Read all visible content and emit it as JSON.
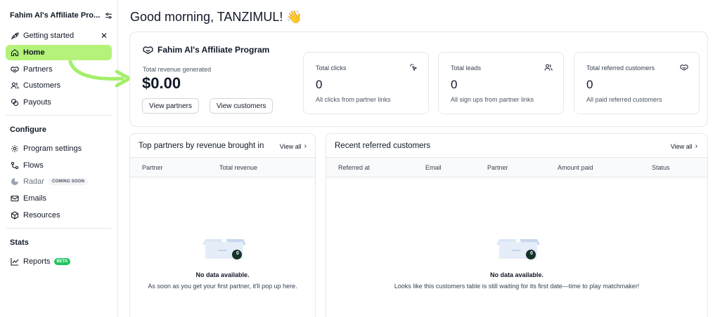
{
  "sidebar": {
    "program_title": "Fahim Al's Affiliate Pro...",
    "items": [
      {
        "label": "Getting started",
        "icon": "rocket-icon"
      },
      {
        "label": "Home",
        "icon": "home-icon"
      },
      {
        "label": "Partners",
        "icon": "handshake-icon"
      },
      {
        "label": "Customers",
        "icon": "users-icon"
      },
      {
        "label": "Payouts",
        "icon": "coins-icon"
      }
    ],
    "configure_heading": "Configure",
    "configure_items": [
      {
        "label": "Program settings",
        "icon": "gear-icon"
      },
      {
        "label": "Flows",
        "icon": "flow-icon"
      },
      {
        "label": "Radar",
        "icon": "radar-icon",
        "badge": "COMING SOON"
      },
      {
        "label": "Emails",
        "icon": "mail-icon"
      },
      {
        "label": "Resources",
        "icon": "package-icon"
      }
    ],
    "stats_heading": "Stats",
    "stats_items": [
      {
        "label": "Reports",
        "icon": "chart-icon",
        "badge": "BETA"
      }
    ],
    "active_color": "#b5f27a"
  },
  "header": {
    "greeting": "Good morning, TANZIMUL! 👋"
  },
  "program": {
    "name": "Fahim Al's Affiliate Program",
    "revenue_label": "Total revenue generated",
    "revenue_value": "$0.00",
    "view_partners_label": "View partners",
    "view_customers_label": "View customers"
  },
  "stats": [
    {
      "title": "Total clicks",
      "value": "0",
      "sub": "All clicks from partner links",
      "icon": "cursor-click-icon"
    },
    {
      "title": "Total leads",
      "value": "0",
      "sub": "All sign ups from partner links",
      "icon": "users-icon"
    },
    {
      "title": "Total referred customers",
      "value": "0",
      "sub": "All paid referred customers",
      "icon": "handshake-icon"
    }
  ],
  "top_partners": {
    "title": "Top partners by revenue brought in",
    "view_all": "View all",
    "columns": [
      "Partner",
      "Total revenue"
    ],
    "empty_count": "0",
    "empty_title": "No data available.",
    "empty_sub": "As soon as you get your first partner, it'll pop up here."
  },
  "recent_customers": {
    "title": "Recent referred customers",
    "view_all": "View all",
    "columns": [
      "Referred at",
      "Email",
      "Partner",
      "Amount paid",
      "Status"
    ],
    "empty_count": "0",
    "empty_title": "No data available.",
    "empty_sub": "Looks like this customers table is still waiting for its first date—time to play matchmaker!"
  }
}
